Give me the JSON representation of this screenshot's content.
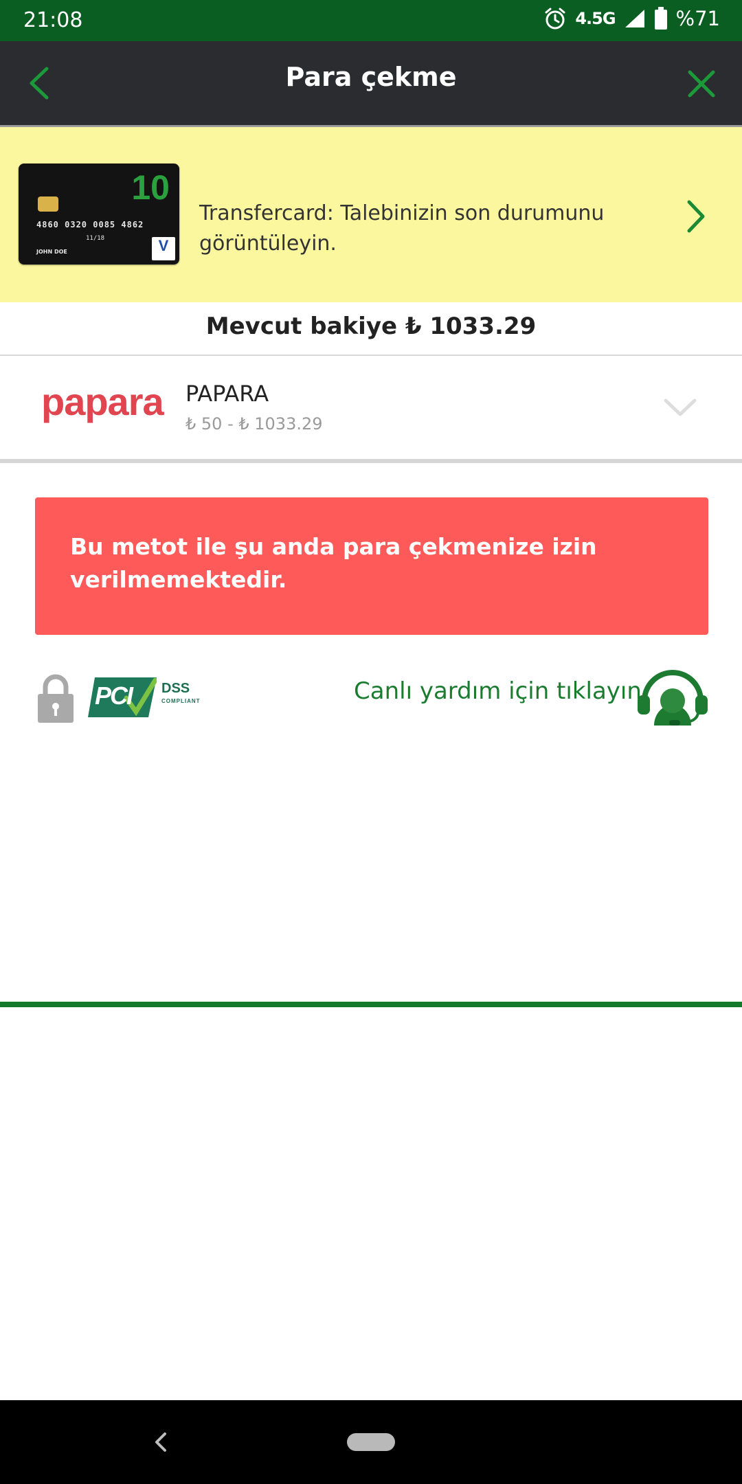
{
  "status_bar": {
    "time": "21:08",
    "network": "4.5G",
    "battery": "%71",
    "icons": [
      "alarm-icon",
      "signal-icon",
      "battery-icon"
    ]
  },
  "app_bar": {
    "title": "Para çekme",
    "back_icon": "chevron-left-icon",
    "close_icon": "close-icon"
  },
  "banner": {
    "card": {
      "number_badge": "10",
      "card_number": "4860 0320 0085 4862",
      "expiry": "11/18",
      "holder": "JOHN DOE",
      "brand_letter": "V"
    },
    "text": "Transfercard: Talebinizin son durumunu görüntüleyin.",
    "arrow_icon": "chevron-right-icon"
  },
  "balance": {
    "text": "Mevcut bakiye ₺ 1033.29"
  },
  "method": {
    "logo": "papara",
    "name": "PAPARA",
    "range": "₺ 50 - ₺ 1033.29",
    "expand_icon": "chevron-down-icon"
  },
  "alert": {
    "message": "Bu metot ile şu anda para çekmenize izin verilmemektedir."
  },
  "trust": {
    "lock_icon": "lock-icon",
    "pci_text": "PCI",
    "dss_text": "DSS",
    "compliant_text": "COMPLIANT",
    "help_text": "Canlı yardım için tıklayın",
    "headset_icon": "headset-icon"
  },
  "colors": {
    "status_bar": "#0b5e22",
    "app_bar": "#2b2c30",
    "accent_green": "#1a7c2e",
    "banner_bg": "#fbf79f",
    "alert_bg": "#fd5a59",
    "papara_red": "#e04550"
  }
}
